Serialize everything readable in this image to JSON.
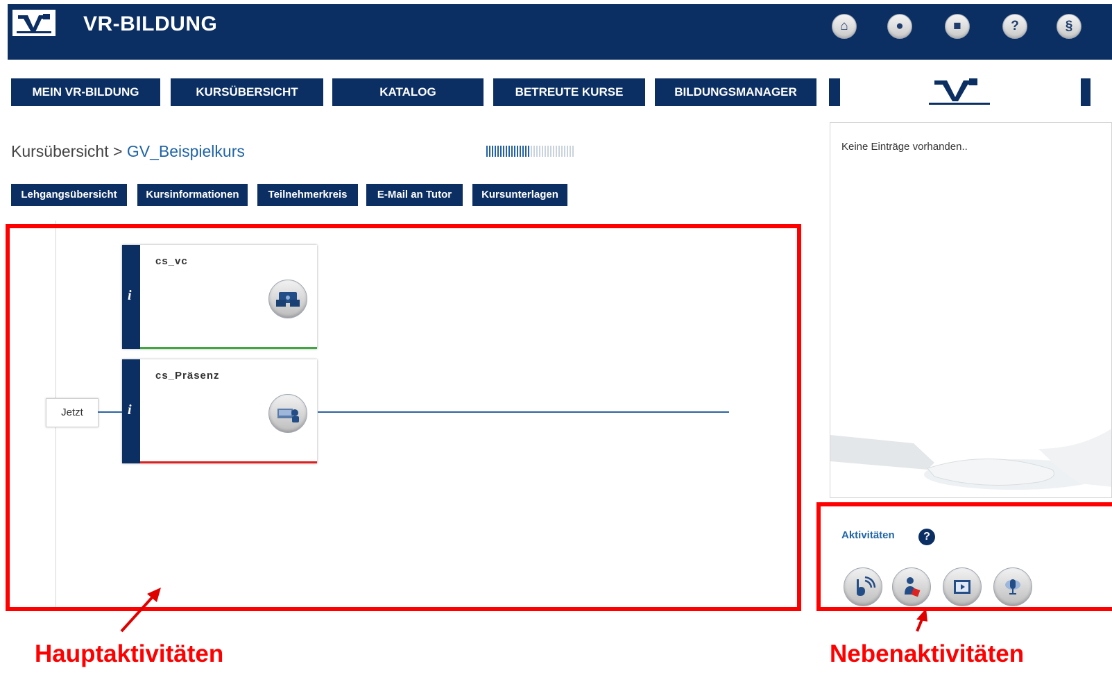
{
  "header": {
    "title": "VR-BILDUNG",
    "icons": [
      {
        "name": "home-icon",
        "glyph": "⌂"
      },
      {
        "name": "user-icon",
        "glyph": "●"
      },
      {
        "name": "lock-icon",
        "glyph": "■"
      },
      {
        "name": "help-icon",
        "glyph": "?"
      },
      {
        "name": "paragraph-icon",
        "glyph": "§"
      }
    ]
  },
  "nav": {
    "items": [
      "MEIN VR-BILDUNG",
      "KURSÜBERSICHT",
      "KATALOG",
      "BETREUTE KURSE",
      "BILDUNGSMANAGER"
    ]
  },
  "breadcrumb": {
    "root": "Kursübersicht",
    "separator": " > ",
    "current": "GV_Beispielkurs"
  },
  "progress": {
    "filled_fraction": 0.5
  },
  "course_tabs": [
    "Lehgangsübersicht",
    "Kursinformationen",
    "Teilnehmerkreis",
    "E-Mail an Tutor",
    "Kursunterlagen"
  ],
  "timeline": {
    "now_label": "Jetzt",
    "cards": [
      {
        "title": "cs_vc",
        "info": "i",
        "status_color": "#3ea83e",
        "icon": "virtual-classroom-icon"
      },
      {
        "title": "cs_Präsenz",
        "info": "i",
        "status_color": "#e02020",
        "icon": "presence-icon"
      }
    ]
  },
  "right_panel": {
    "empty_message": "Keine Einträge vorhanden..",
    "activities_title": "Aktivitäten",
    "help": "?",
    "activity_icons": [
      "blog-icon",
      "person-icon",
      "video-icon",
      "podcast-icon"
    ]
  },
  "annotations": {
    "main": "Hauptaktivitäten",
    "side": "Nebenaktivitäten"
  },
  "colors": {
    "brand_navy": "#0b2f63",
    "link_blue": "#1f64a6",
    "highlight_red": "#ff0000"
  }
}
